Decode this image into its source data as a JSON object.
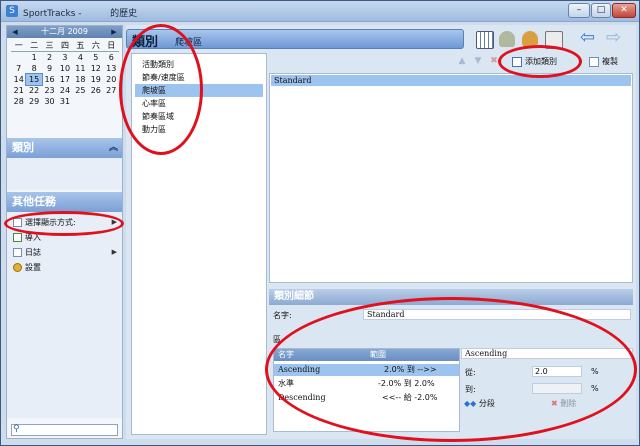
{
  "window": {
    "title": "SportTracks -          的歷史",
    "controls": [
      "minimize",
      "maximize",
      "close"
    ]
  },
  "calendar": {
    "month_label": "十二月 2009",
    "prev_icon": "triangle-left-icon",
    "next_icon": "triangle-right-icon",
    "weekdays": [
      "一",
      "二",
      "三",
      "四",
      "五",
      "六",
      "日"
    ],
    "weeks": [
      [
        "",
        "1",
        "2",
        "3",
        "4",
        "5",
        "6"
      ],
      [
        "7",
        "8",
        "9",
        "10",
        "11",
        "12",
        "13"
      ],
      [
        "14",
        "15",
        "16",
        "17",
        "18",
        "19",
        "20"
      ],
      [
        "21",
        "22",
        "23",
        "24",
        "25",
        "26",
        "27"
      ],
      [
        "28",
        "29",
        "30",
        "31",
        "",
        "",
        ""
      ]
    ],
    "selected_day": "15"
  },
  "sidebar": {
    "categories_title": "類別",
    "tasks_title": "其他任務",
    "tasks": [
      {
        "label": "選擇顯示方式:",
        "icon": "view-icon",
        "has_submenu": true
      },
      {
        "label": "導入",
        "icon": "import-icon",
        "has_submenu": false
      },
      {
        "label": "日誌",
        "icon": "journal-icon",
        "has_submenu": true
      },
      {
        "label": "設置",
        "icon": "settings-icon",
        "has_submenu": false
      }
    ]
  },
  "breadcrumb": {
    "main": "類別",
    "sub": "爬坡區"
  },
  "category_list": [
    "活動類別",
    "節奏/速度區",
    "爬坡區",
    "心率區",
    "節奏區域",
    "動力區"
  ],
  "selected_category": "爬坡區",
  "toolbar": {
    "add_label": "添加類別",
    "copy_label": "複製"
  },
  "subcategories": [
    "Standard"
  ],
  "details": {
    "title": "類別細節",
    "name_label": "名字:",
    "name_value": "Standard",
    "zone_label": "區"
  },
  "zone_table": {
    "columns": [
      "名字",
      "範圍"
    ],
    "rows": [
      {
        "name": "Ascending",
        "range": "2.0% 到 -->>"
      },
      {
        "name": "水準",
        "range": "-2.0% 到 2.0%"
      },
      {
        "name": "Descending",
        "range": "<<-- 給 -2.0%"
      }
    ],
    "selected": 0
  },
  "zone_detail": {
    "name": "Ascending",
    "from_label": "從:",
    "from_value": "2.0",
    "to_label": "到:",
    "to_value": "",
    "unit": "%",
    "split_label": "分段",
    "delete_label": "刪除"
  },
  "colors": {
    "annotation": "#e0101c",
    "selection": "#9dc3ef",
    "header_blue": "#7aa0d6"
  }
}
